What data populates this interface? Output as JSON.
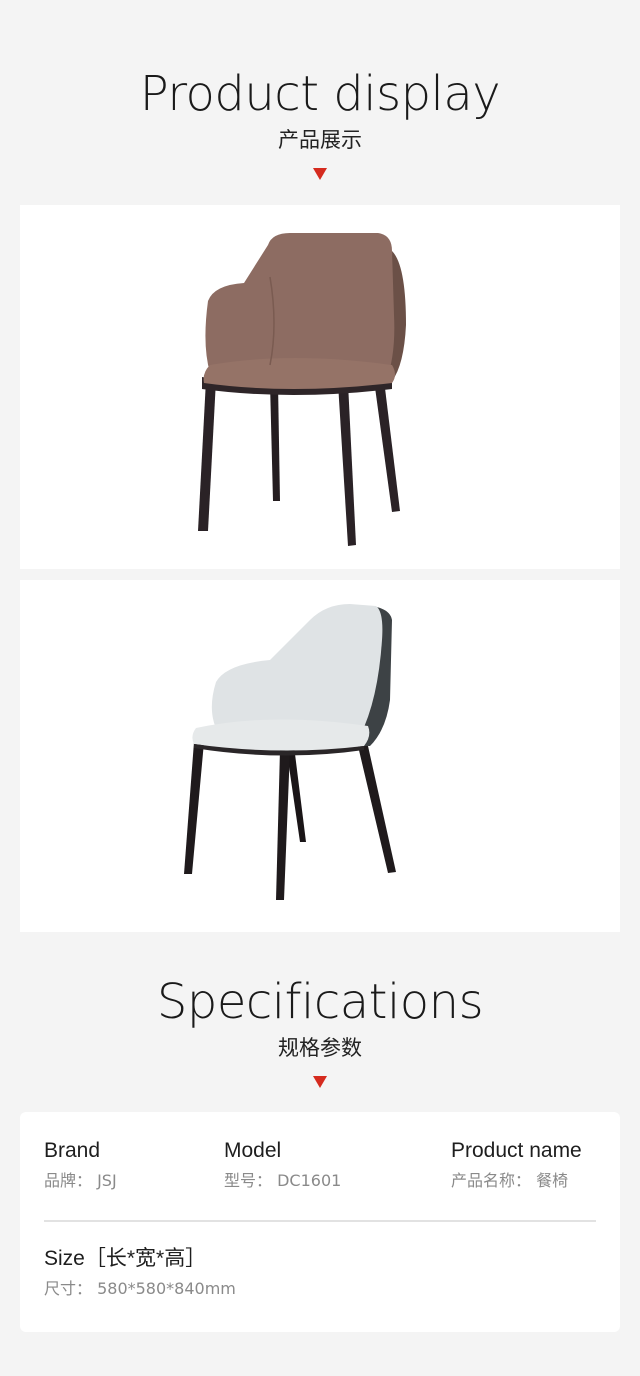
{
  "product_display": {
    "title_en": "Product display",
    "title_cn": "产品展示"
  },
  "images": [
    {
      "icon": "chair-brown-photo"
    },
    {
      "icon": "chair-white-photo"
    }
  ],
  "specifications": {
    "title_en": "Specifications",
    "title_cn": "规格参数",
    "brand_label": "Brand",
    "brand_value": "品牌：  JSJ",
    "model_label": "Model",
    "model_value": "型号：  DC1601",
    "product_name_label": "Product name",
    "product_name_value": "产品名称：  餐椅",
    "size_label": "Size［长*宽*高］",
    "size_value": "尺寸：  580*580*840mm"
  },
  "colors": {
    "accent": "#d52a1e",
    "background": "#f4f4f4",
    "card": "#ffffff"
  }
}
